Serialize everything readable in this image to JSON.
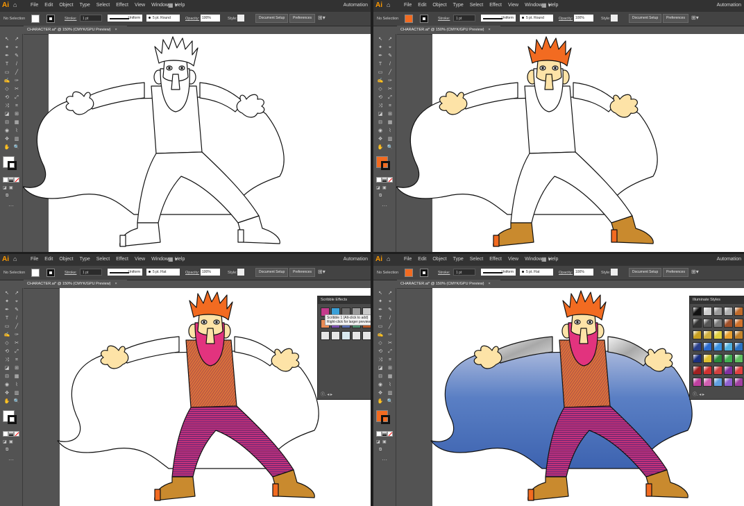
{
  "app": {
    "logo": "Ai",
    "menus": [
      "File",
      "Edit",
      "Object",
      "Type",
      "Select",
      "Effect",
      "View",
      "Window",
      "Help"
    ],
    "workspace": "Automation"
  },
  "control_bar": {
    "selection": "No Selection",
    "stroke_label": "Stroke:",
    "weight": "1 pt",
    "profile": "Uniform",
    "opacity_label": "Opacity:",
    "opacity": "100%",
    "style_label": "Style:",
    "doc_setup": "Document Setup",
    "preferences": "Preferences",
    "brushes": [
      "5 pt. Round",
      "5 pt. Round",
      "5 pt. Flat",
      "5 pt. Flat"
    ],
    "fill_colors": [
      "#ffffff",
      "#f26b21",
      "#ffffff",
      "#f26b21"
    ]
  },
  "document_tab": {
    "title": "CHARACTER.ai* @ 150% (CMYK/GPU Preview)",
    "close": "×"
  },
  "toolbar": {
    "tools": [
      "↖",
      "↗",
      "✦",
      "⌖",
      "✒",
      "✎",
      "T",
      "/",
      "▭",
      "╱",
      "✍",
      "✑",
      "◇",
      "✂",
      "⟲",
      "⤢",
      "⤨",
      "⌗",
      "◪",
      "⊞",
      "⊟",
      "▦",
      "◉",
      "⌇",
      "✥",
      "▥",
      "✋",
      "🔍"
    ]
  },
  "panels": {
    "scribble": {
      "title": "Scribble Effects",
      "tooltip_line1": "Scribble 1 (Alt-click to add)",
      "tooltip_line2": "Right-click for larger preview"
    },
    "illuminate": {
      "title": "Illuminate Styles"
    }
  },
  "colors": {
    "orange": "#f26b21",
    "skin": "#fde3a7",
    "boot": "#c98a2e",
    "cape": "#4a6fb5",
    "pink": "#e2337e",
    "purple": "#6b2f9a"
  }
}
